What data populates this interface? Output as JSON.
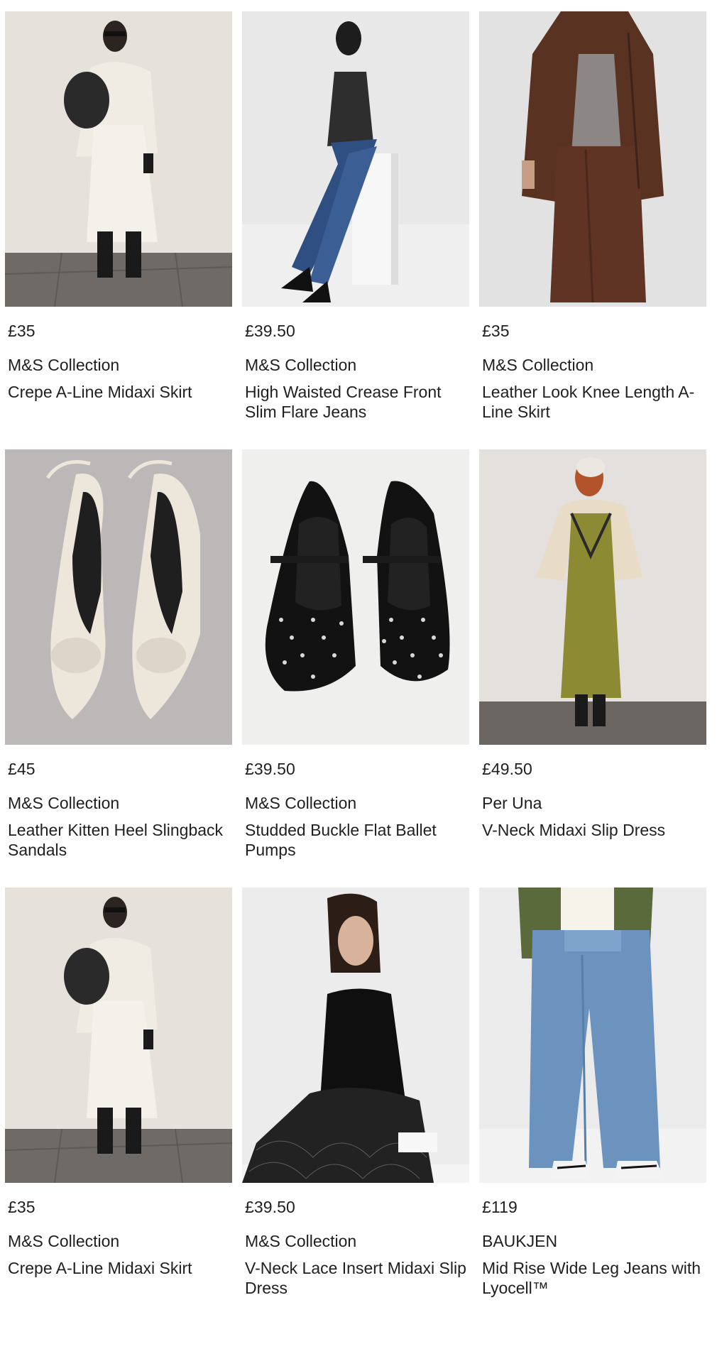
{
  "products": [
    {
      "price": "£35",
      "brand": "M&S Collection",
      "title": "Crepe A-Line Midaxi Skirt",
      "image": "model-cream-coat-skirt-boots"
    },
    {
      "price": "£39.50",
      "brand": "M&S Collection",
      "title": "High Waisted Crease Front Slim Flare Jeans",
      "image": "model-seated-flare-jeans"
    },
    {
      "price": "£35",
      "brand": "M&S Collection",
      "title": "Leather Look Knee Length A-Line Skirt",
      "image": "model-brown-leather-jacket-skirt"
    },
    {
      "price": "£45",
      "brand": "M&S Collection",
      "title": "Leather Kitten Heel Slingback Sandals",
      "image": "cream-bow-slingback-heels"
    },
    {
      "price": "£39.50",
      "brand": "M&S Collection",
      "title": "Studded Buckle Flat Ballet Pumps",
      "image": "black-studded-ballet-pumps"
    },
    {
      "price": "£49.50",
      "brand": "Per Una",
      "title": "V-Neck Midaxi Slip Dress",
      "image": "model-olive-slip-dress-shearling"
    },
    {
      "price": "£35",
      "brand": "M&S Collection",
      "title": "Crepe A-Line Midaxi Skirt",
      "image": "model-cream-coat-skirt-boots"
    },
    {
      "price": "£39.50",
      "brand": "M&S Collection",
      "title": "V-Neck Lace Insert Midaxi Slip Dress",
      "image": "model-black-lace-slip-dress"
    },
    {
      "price": "£119",
      "brand": "BAUKJEN",
      "title": "Mid Rise Wide Leg Jeans with Lyocell™",
      "image": "model-wide-leg-jeans-sneakers"
    }
  ]
}
